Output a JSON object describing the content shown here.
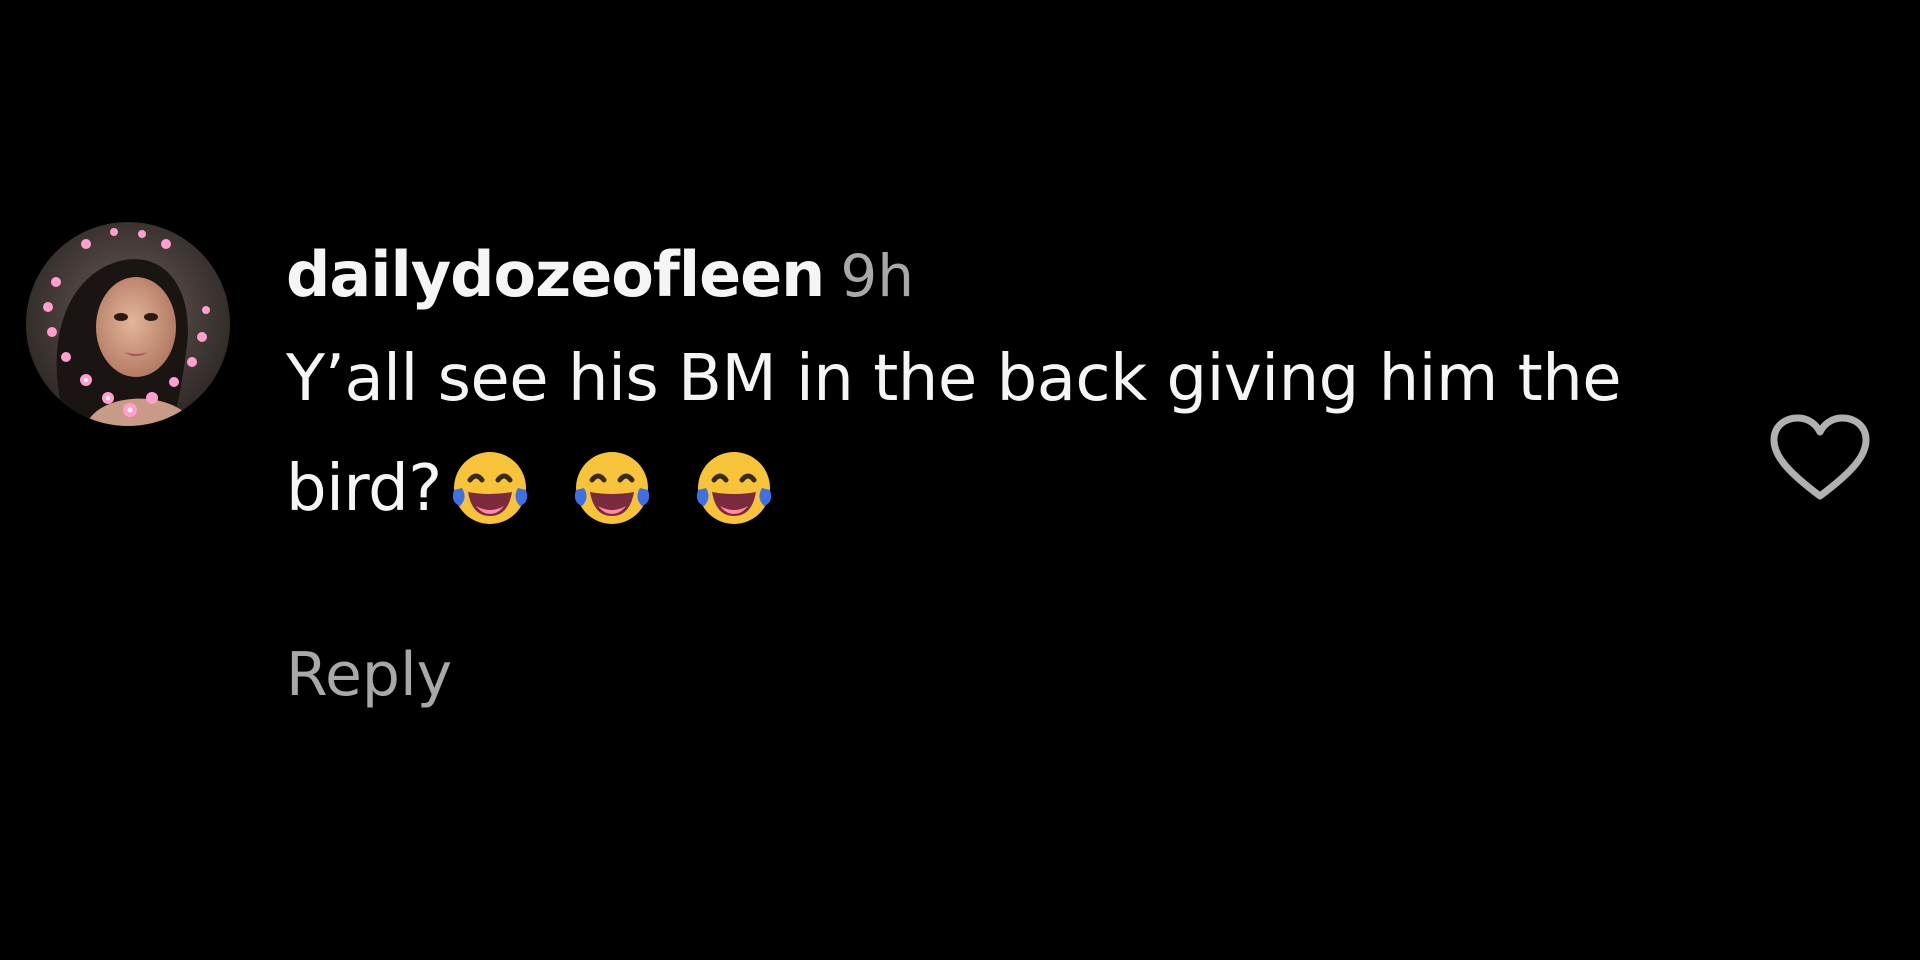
{
  "comment": {
    "username": "dailydozeofleen",
    "timestamp": "9h",
    "text": "Y’all see his BM in the back giving him the bird?",
    "emojis": [
      "face-with-tears-of-joy",
      "face-with-tears-of-joy",
      "face-with-tears-of-joy"
    ],
    "reply_label": "Reply",
    "like_icon": "heart-outline-icon"
  },
  "colors": {
    "background": "#000000",
    "primary_text": "#f5f5f5",
    "secondary_text": "#a8a8a8",
    "emoji_face": "#f6c33b",
    "emoji_tears": "#3f6fe0"
  }
}
